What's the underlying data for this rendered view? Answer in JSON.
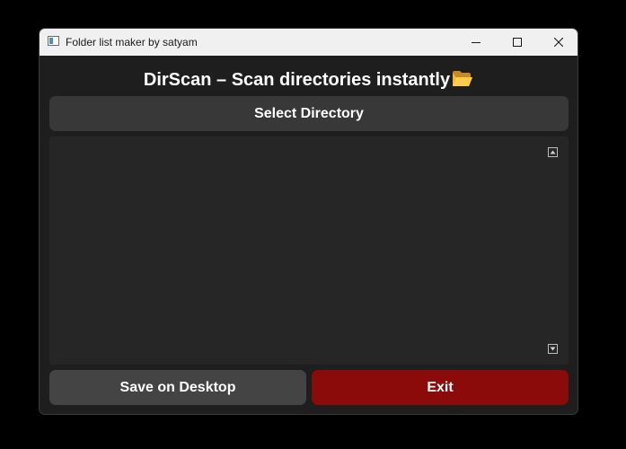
{
  "window": {
    "title": "Folder list maker by satyam"
  },
  "header": {
    "title": "DirScan – Scan directories instantly",
    "icon": "open-folder-icon"
  },
  "actions": {
    "select_label": "Select Directory",
    "save_label": "Save on Desktop",
    "exit_label": "Exit"
  },
  "output": {
    "content": ""
  },
  "colors": {
    "background": "#1e1e1e",
    "select_button": "#383838",
    "save_button": "#444444",
    "exit_button": "#8b0a0a",
    "text": "#ffffff"
  }
}
